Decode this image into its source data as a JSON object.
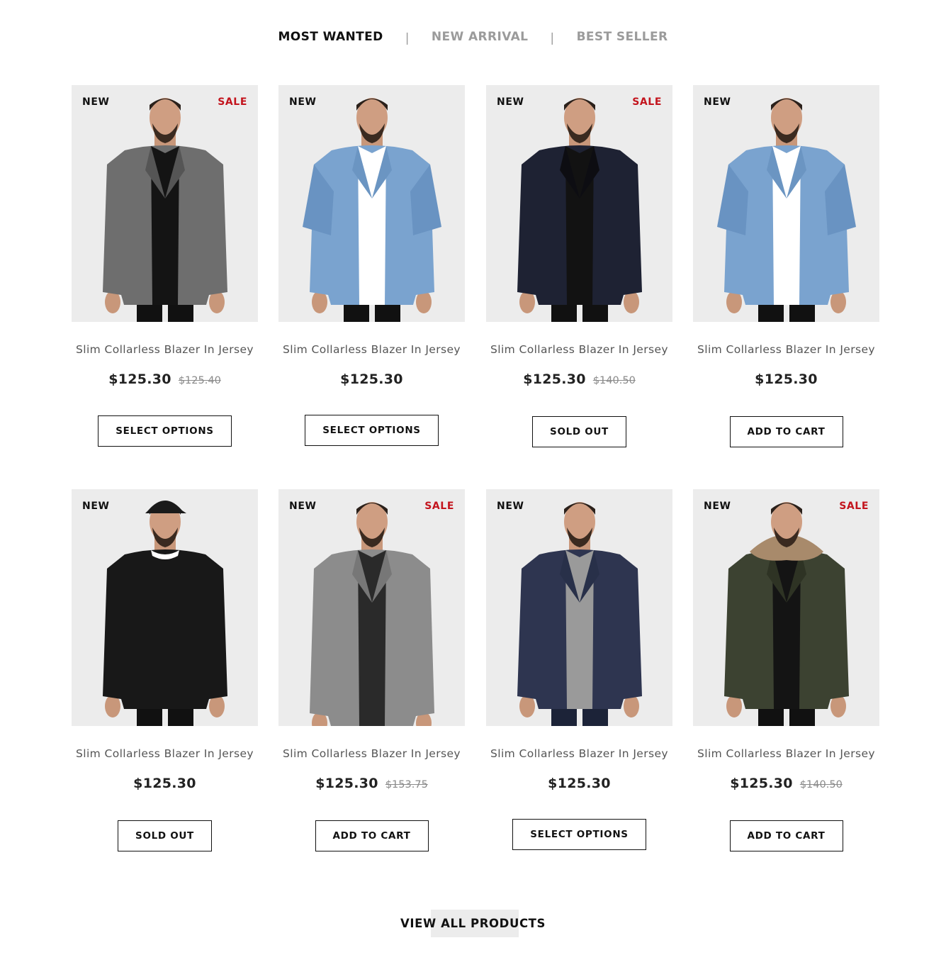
{
  "tabs": [
    {
      "label": "MOST WANTED",
      "active": true
    },
    {
      "label": "NEW ARRIVAL",
      "active": false
    },
    {
      "label": "BEST SELLER",
      "active": false
    }
  ],
  "tab_separator": "|",
  "products": [
    {
      "badge_new": "NEW",
      "badge_sale": "SALE",
      "name": "Slim Collarless Blazer In Jersey",
      "price": "$125.30",
      "old_price": "$125.40",
      "button": "SELECT OPTIONS",
      "garment": "grey-blazer"
    },
    {
      "badge_new": "NEW",
      "badge_sale": "",
      "name": "Slim Collarless Blazer In Jersey",
      "price": "$125.30",
      "old_price": "",
      "button": "SELECT OPTIONS",
      "garment": "denim-kimono"
    },
    {
      "badge_new": "NEW",
      "badge_sale": "SALE",
      "name": "Slim Collarless Blazer In Jersey",
      "price": "$125.30",
      "old_price": "$140.50",
      "button": "SOLD OUT",
      "garment": "navy-blazer"
    },
    {
      "badge_new": "NEW",
      "badge_sale": "",
      "name": "Slim Collarless Blazer In Jersey",
      "price": "$125.30",
      "old_price": "",
      "button": "ADD TO CART",
      "garment": "denim-kimono"
    },
    {
      "badge_new": "NEW",
      "badge_sale": "",
      "name": "Slim Collarless Blazer In Jersey",
      "price": "$125.30",
      "old_price": "",
      "button": "SOLD OUT",
      "garment": "black-sweater"
    },
    {
      "badge_new": "NEW",
      "badge_sale": "SALE",
      "name": "Slim Collarless Blazer In Jersey",
      "price": "$125.30",
      "old_price": "$153.75",
      "button": "ADD TO CART",
      "garment": "grey-overcoat"
    },
    {
      "badge_new": "NEW",
      "badge_sale": "",
      "name": "Slim Collarless Blazer In Jersey",
      "price": "$125.30",
      "old_price": "",
      "button": "SELECT OPTIONS",
      "garment": "navy-tweed-blazer"
    },
    {
      "badge_new": "NEW",
      "badge_sale": "SALE",
      "name": "Slim Collarless Blazer In Jersey",
      "price": "$125.30",
      "old_price": "$140.50",
      "button": "ADD TO CART",
      "garment": "green-parka"
    }
  ],
  "view_all_label": "VIEW ALL PRODUCTS",
  "colors": {
    "sale": "#c3141d",
    "active_tab": "#111111",
    "inactive_tab": "#9b9b9b",
    "photo_bg": "#ececec"
  }
}
